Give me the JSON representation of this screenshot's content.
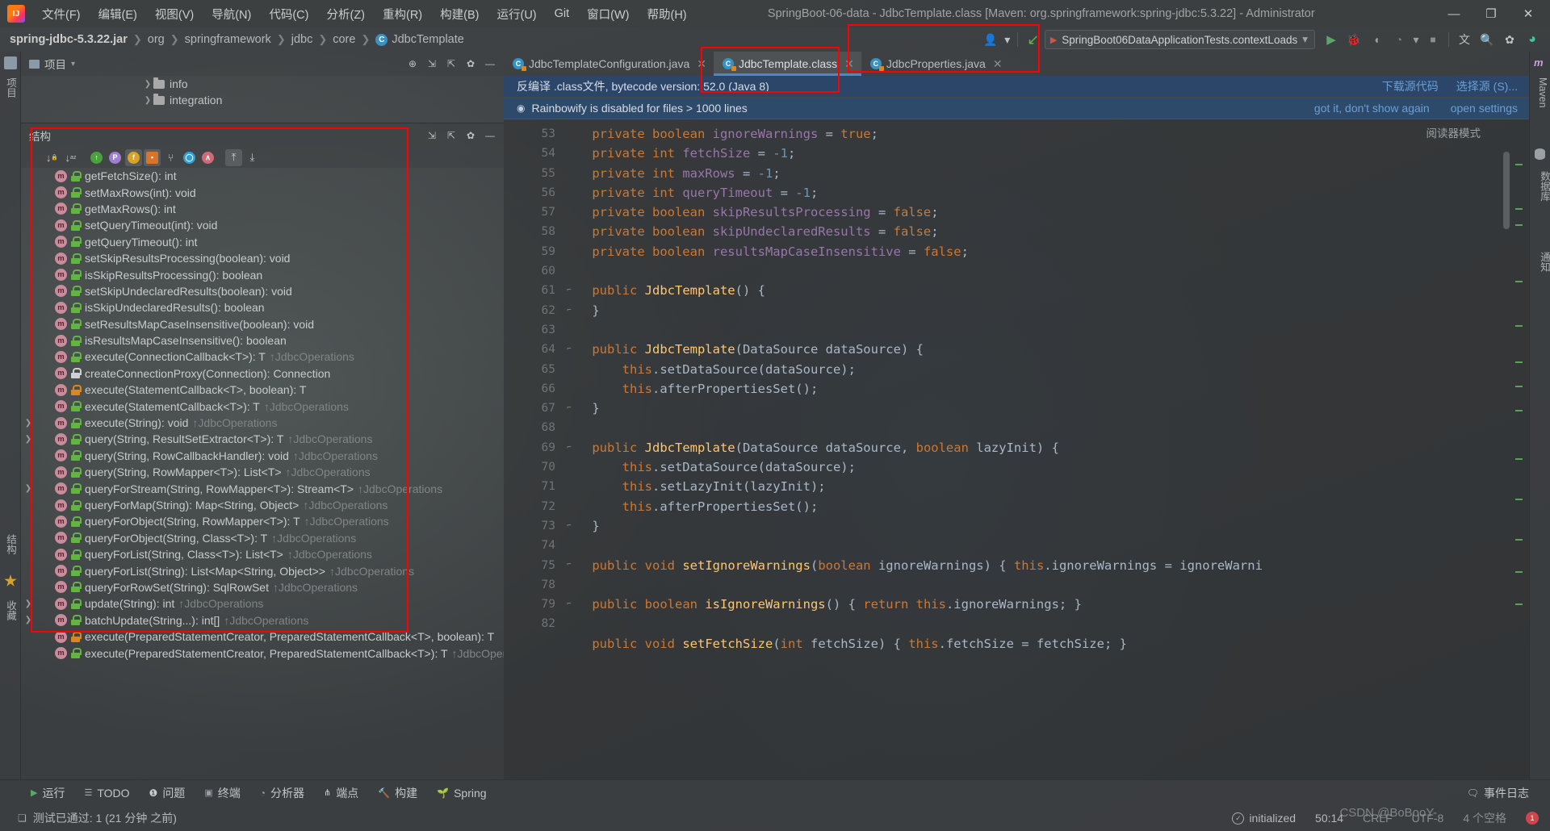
{
  "window": {
    "title": "SpringBoot-06-data - JdbcTemplate.class [Maven: org.springframework:spring-jdbc:5.3.22] - Administrator",
    "minimize": "—",
    "maximize": "❐",
    "close": "✕"
  },
  "menubar": {
    "items": [
      {
        "label": "文件(F)"
      },
      {
        "label": "编辑(E)"
      },
      {
        "label": "视图(V)"
      },
      {
        "label": "导航(N)"
      },
      {
        "label": "代码(C)"
      },
      {
        "label": "分析(Z)"
      },
      {
        "label": "重构(R)"
      },
      {
        "label": "构建(B)"
      },
      {
        "label": "运行(U)"
      },
      {
        "label": "Git"
      },
      {
        "label": "窗口(W)"
      },
      {
        "label": "帮助(H)"
      }
    ]
  },
  "breadcrumb": {
    "items": [
      "spring-jdbc-5.3.22.jar",
      "org",
      "springframework",
      "jdbc",
      "core",
      "JdbcTemplate"
    ],
    "separator": "❯",
    "class_icon": "C"
  },
  "run_toolbar": {
    "config_label": "SpringBoot06DataApplicationTests.contextLoads",
    "config_chevron": "▾",
    "run_icon": "▶",
    "debug_icon": "🐞",
    "run_coverage_icon": "◖",
    "profile_icon": "◔",
    "profile_chevron": "▾",
    "stop_icon": "■",
    "translate_icon": "文",
    "search_icon": "🔍",
    "settings_icon": "✿",
    "avatar_icon": "◕",
    "user_icon": "👤",
    "user_chevron": "▾",
    "vcs_update_icon": "↙"
  },
  "project_pane": {
    "title": "项目",
    "chevron": "▾",
    "actions": [
      "⊕",
      "⇲",
      "⇱",
      "✿",
      "—"
    ],
    "rows": [
      {
        "label": "info",
        "arrow": "❯"
      },
      {
        "label": "integration",
        "arrow": "❯"
      }
    ]
  },
  "structure_pane": {
    "title": "结构",
    "actions": [
      "⇲",
      "⇱",
      "✿",
      "—"
    ],
    "toolbar": [
      {
        "name": "sort-by-visibility",
        "glyph": "↓"
      },
      {
        "name": "sort-alphabetically",
        "glyph": "↓"
      },
      {
        "name": "show-inherited",
        "glyph": "↑",
        "color": "#62b543"
      },
      {
        "name": "show-properties",
        "glyph": "P",
        "color": "#9f7fd4"
      },
      {
        "name": "show-fields",
        "glyph": "f",
        "color": "#d9a22a"
      },
      {
        "name": "show-non-public",
        "glyph": "▪",
        "color": "#5a5d5f"
      },
      {
        "name": "show-anonymous",
        "glyph": "⑂",
        "color": "#c8cbcd"
      },
      {
        "name": "show-lambdas",
        "glyph": "◯",
        "color": "#3592c4"
      },
      {
        "name": "show-overrides",
        "glyph": "∧",
        "color": "#cf6a7a"
      },
      {
        "name": "expand-all",
        "glyph": "⤒"
      },
      {
        "name": "collapse-all",
        "glyph": "⤓"
      }
    ],
    "members": [
      {
        "name": "getFetchSize(): int",
        "vis": "pub",
        "arrow": "",
        "owner": ""
      },
      {
        "name": "setMaxRows(int): void",
        "vis": "pub",
        "arrow": "",
        "owner": ""
      },
      {
        "name": "getMaxRows(): int",
        "vis": "pub",
        "arrow": "",
        "owner": ""
      },
      {
        "name": "setQueryTimeout(int): void",
        "vis": "pub",
        "arrow": "",
        "owner": ""
      },
      {
        "name": "getQueryTimeout(): int",
        "vis": "pub",
        "arrow": "",
        "owner": ""
      },
      {
        "name": "setSkipResultsProcessing(boolean): void",
        "vis": "pub",
        "arrow": "",
        "owner": ""
      },
      {
        "name": "isSkipResultsProcessing(): boolean",
        "vis": "pub",
        "arrow": "",
        "owner": ""
      },
      {
        "name": "setSkipUndeclaredResults(boolean): void",
        "vis": "pub",
        "arrow": "",
        "owner": ""
      },
      {
        "name": "isSkipUndeclaredResults(): boolean",
        "vis": "pub",
        "arrow": "",
        "owner": ""
      },
      {
        "name": "setResultsMapCaseInsensitive(boolean): void",
        "vis": "pub",
        "arrow": "",
        "owner": ""
      },
      {
        "name": "isResultsMapCaseInsensitive(): boolean",
        "vis": "pub",
        "arrow": "",
        "owner": ""
      },
      {
        "name": "execute(ConnectionCallback<T>): T",
        "vis": "pub",
        "arrow": "",
        "owner": "↑JdbcOperations"
      },
      {
        "name": "createConnectionProxy(Connection): Connection",
        "vis": "priv",
        "arrow": "",
        "owner": ""
      },
      {
        "name": "execute(StatementCallback<T>, boolean): T",
        "vis": "prot",
        "arrow": "",
        "owner": ""
      },
      {
        "name": "execute(StatementCallback<T>): T",
        "vis": "pub",
        "arrow": "",
        "owner": "↑JdbcOperations"
      },
      {
        "name": "execute(String): void",
        "vis": "pub",
        "arrow": "❯",
        "owner": "↑JdbcOperations"
      },
      {
        "name": "query(String, ResultSetExtractor<T>): T",
        "vis": "pub",
        "arrow": "❯",
        "owner": "↑JdbcOperations"
      },
      {
        "name": "query(String, RowCallbackHandler): void",
        "vis": "pub",
        "arrow": "",
        "owner": "↑JdbcOperations"
      },
      {
        "name": "query(String, RowMapper<T>): List<T>",
        "vis": "pub",
        "arrow": "",
        "owner": "↑JdbcOperations"
      },
      {
        "name": "queryForStream(String, RowMapper<T>): Stream<T>",
        "vis": "pub",
        "arrow": "❯",
        "owner": "↑JdbcOperations"
      },
      {
        "name": "queryForMap(String): Map<String, Object>",
        "vis": "pub",
        "arrow": "",
        "owner": "↑JdbcOperations"
      },
      {
        "name": "queryForObject(String, RowMapper<T>): T",
        "vis": "pub",
        "arrow": "",
        "owner": "↑JdbcOperations"
      },
      {
        "name": "queryForObject(String, Class<T>): T",
        "vis": "pub",
        "arrow": "",
        "owner": "↑JdbcOperations"
      },
      {
        "name": "queryForList(String, Class<T>): List<T>",
        "vis": "pub",
        "arrow": "",
        "owner": "↑JdbcOperations"
      },
      {
        "name": "queryForList(String): List<Map<String, Object>>",
        "vis": "pub",
        "arrow": "",
        "owner": "↑JdbcOperations"
      },
      {
        "name": "queryForRowSet(String): SqlRowSet",
        "vis": "pub",
        "arrow": "",
        "owner": "↑JdbcOperations"
      },
      {
        "name": "update(String): int",
        "vis": "pub",
        "arrow": "❯",
        "owner": "↑JdbcOperations"
      },
      {
        "name": "batchUpdate(String...): int[]",
        "vis": "pub",
        "arrow": "❯",
        "owner": "↑JdbcOperations"
      },
      {
        "name": "execute(PreparedStatementCreator, PreparedStatementCallback<T>, boolean): T",
        "vis": "prot",
        "arrow": "",
        "owner": ""
      },
      {
        "name": "execute(PreparedStatementCreator, PreparedStatementCallback<T>): T",
        "vis": "pub",
        "arrow": "",
        "owner": "↑JdbcOperatio"
      }
    ]
  },
  "editor": {
    "tabs": [
      {
        "label": "JdbcTemplateConfiguration.java",
        "active": false,
        "close": "✕"
      },
      {
        "label": "JdbcTemplate.class",
        "active": true,
        "close": "✕"
      },
      {
        "label": "JdbcProperties.java",
        "active": false,
        "close": "✕"
      }
    ],
    "decompile_notice": {
      "text": "反编译 .class文件, bytecode version: 52.0 (Java 8)",
      "links": [
        "下载源代码",
        "选择源 (S)..."
      ]
    },
    "rainbowify_notice": {
      "icon": "◉",
      "text": "Rainbowify is disabled for files > 1000 lines",
      "links": [
        "got it, don't show again",
        "open settings"
      ]
    },
    "reader_mode_label": "阅读器模式",
    "lines": [
      {
        "n": "53",
        "fold": "",
        "tokens": [
          {
            "t": "    ",
            "c": "def"
          },
          {
            "t": "private ",
            "c": "kw"
          },
          {
            "t": "boolean ",
            "c": "kw"
          },
          {
            "t": "ignoreWarnings",
            "c": "fld"
          },
          {
            "t": " = ",
            "c": "def"
          },
          {
            "t": "true",
            "c": "kw"
          },
          {
            "t": ";",
            "c": "def"
          }
        ]
      },
      {
        "n": "54",
        "fold": "",
        "tokens": [
          {
            "t": "    ",
            "c": "def"
          },
          {
            "t": "private ",
            "c": "kw"
          },
          {
            "t": "int ",
            "c": "kw"
          },
          {
            "t": "fetchSize",
            "c": "fld"
          },
          {
            "t": " = ",
            "c": "def"
          },
          {
            "t": "-1",
            "c": "num"
          },
          {
            "t": ";",
            "c": "def"
          }
        ]
      },
      {
        "n": "55",
        "fold": "",
        "tokens": [
          {
            "t": "    ",
            "c": "def"
          },
          {
            "t": "private ",
            "c": "kw"
          },
          {
            "t": "int ",
            "c": "kw"
          },
          {
            "t": "maxRows",
            "c": "fld"
          },
          {
            "t": " = ",
            "c": "def"
          },
          {
            "t": "-1",
            "c": "num"
          },
          {
            "t": ";",
            "c": "def"
          }
        ]
      },
      {
        "n": "56",
        "fold": "",
        "tokens": [
          {
            "t": "    ",
            "c": "def"
          },
          {
            "t": "private ",
            "c": "kw"
          },
          {
            "t": "int ",
            "c": "kw"
          },
          {
            "t": "queryTimeout",
            "c": "fld"
          },
          {
            "t": " = ",
            "c": "def"
          },
          {
            "t": "-1",
            "c": "num"
          },
          {
            "t": ";",
            "c": "def"
          }
        ]
      },
      {
        "n": "57",
        "fold": "",
        "tokens": [
          {
            "t": "    ",
            "c": "def"
          },
          {
            "t": "private ",
            "c": "kw"
          },
          {
            "t": "boolean ",
            "c": "kw"
          },
          {
            "t": "skipResultsProcessing",
            "c": "fld"
          },
          {
            "t": " = ",
            "c": "def"
          },
          {
            "t": "false",
            "c": "kw"
          },
          {
            "t": ";",
            "c": "def"
          }
        ]
      },
      {
        "n": "58",
        "fold": "",
        "tokens": [
          {
            "t": "    ",
            "c": "def"
          },
          {
            "t": "private ",
            "c": "kw"
          },
          {
            "t": "boolean ",
            "c": "kw"
          },
          {
            "t": "skipUndeclaredResults",
            "c": "fld"
          },
          {
            "t": " = ",
            "c": "def"
          },
          {
            "t": "false",
            "c": "kw"
          },
          {
            "t": ";",
            "c": "def"
          }
        ]
      },
      {
        "n": "59",
        "fold": "",
        "tokens": [
          {
            "t": "    ",
            "c": "def"
          },
          {
            "t": "private ",
            "c": "kw"
          },
          {
            "t": "boolean ",
            "c": "kw"
          },
          {
            "t": "resultsMapCaseInsensitive",
            "c": "fld"
          },
          {
            "t": " = ",
            "c": "def"
          },
          {
            "t": "false",
            "c": "kw"
          },
          {
            "t": ";",
            "c": "def"
          }
        ]
      },
      {
        "n": "60",
        "fold": "",
        "tokens": []
      },
      {
        "n": "61",
        "fold": "⌐",
        "tokens": [
          {
            "t": "    ",
            "c": "def"
          },
          {
            "t": "public ",
            "c": "kw"
          },
          {
            "t": "JdbcTemplate",
            "c": "fn"
          },
          {
            "t": "() {",
            "c": "def"
          }
        ]
      },
      {
        "n": "62",
        "fold": "⌐",
        "tokens": [
          {
            "t": "    }",
            "c": "def"
          }
        ]
      },
      {
        "n": "63",
        "fold": "",
        "tokens": []
      },
      {
        "n": "64",
        "fold": "⌐",
        "tokens": [
          {
            "t": "    ",
            "c": "def"
          },
          {
            "t": "public ",
            "c": "kw"
          },
          {
            "t": "JdbcTemplate",
            "c": "fn"
          },
          {
            "t": "(DataSource dataSource) {",
            "c": "def"
          }
        ]
      },
      {
        "n": "65",
        "fold": "",
        "tokens": [
          {
            "t": "        ",
            "c": "def"
          },
          {
            "t": "this",
            "c": "kw"
          },
          {
            "t": ".setDataSource(dataSource);",
            "c": "def"
          }
        ]
      },
      {
        "n": "66",
        "fold": "",
        "tokens": [
          {
            "t": "        ",
            "c": "def"
          },
          {
            "t": "this",
            "c": "kw"
          },
          {
            "t": ".afterPropertiesSet();",
            "c": "def"
          }
        ]
      },
      {
        "n": "67",
        "fold": "⌐",
        "tokens": [
          {
            "t": "    }",
            "c": "def"
          }
        ]
      },
      {
        "n": "68",
        "fold": "",
        "tokens": []
      },
      {
        "n": "69",
        "fold": "⌐",
        "tokens": [
          {
            "t": "    ",
            "c": "def"
          },
          {
            "t": "public ",
            "c": "kw"
          },
          {
            "t": "JdbcTemplate",
            "c": "fn"
          },
          {
            "t": "(DataSource dataSource, ",
            "c": "def"
          },
          {
            "t": "boolean ",
            "c": "kw"
          },
          {
            "t": "lazyInit) {",
            "c": "def"
          }
        ]
      },
      {
        "n": "70",
        "fold": "",
        "tokens": [
          {
            "t": "        ",
            "c": "def"
          },
          {
            "t": "this",
            "c": "kw"
          },
          {
            "t": ".setDataSource(dataSource);",
            "c": "def"
          }
        ]
      },
      {
        "n": "71",
        "fold": "",
        "tokens": [
          {
            "t": "        ",
            "c": "def"
          },
          {
            "t": "this",
            "c": "kw"
          },
          {
            "t": ".setLazyInit(lazyInit);",
            "c": "def"
          }
        ]
      },
      {
        "n": "72",
        "fold": "",
        "tokens": [
          {
            "t": "        ",
            "c": "def"
          },
          {
            "t": "this",
            "c": "kw"
          },
          {
            "t": ".afterPropertiesSet();",
            "c": "def"
          }
        ]
      },
      {
        "n": "73",
        "fold": "⌐",
        "tokens": [
          {
            "t": "    }",
            "c": "def"
          }
        ]
      },
      {
        "n": "74",
        "fold": "",
        "tokens": []
      },
      {
        "n": "75",
        "fold": "⌐",
        "tokens": [
          {
            "t": "    ",
            "c": "def"
          },
          {
            "t": "public ",
            "c": "kw"
          },
          {
            "t": "void ",
            "c": "kw"
          },
          {
            "t": "setIgnoreWarnings",
            "c": "fn"
          },
          {
            "t": "(",
            "c": "def"
          },
          {
            "t": "boolean ",
            "c": "kw"
          },
          {
            "t": "ignoreWarnings) { ",
            "c": "def"
          },
          {
            "t": "this",
            "c": "kw"
          },
          {
            "t": ".ignoreWarnings = ignoreWarni",
            "c": "def"
          }
        ]
      },
      {
        "n": "78",
        "fold": "",
        "tokens": []
      },
      {
        "n": "79",
        "fold": "⌐",
        "tokens": [
          {
            "t": "    ",
            "c": "def"
          },
          {
            "t": "public ",
            "c": "kw"
          },
          {
            "t": "boolean ",
            "c": "kw"
          },
          {
            "t": "isIgnoreWarnings",
            "c": "fn"
          },
          {
            "t": "() { ",
            "c": "def"
          },
          {
            "t": "return ",
            "c": "kw"
          },
          {
            "t": "this",
            "c": "kw"
          },
          {
            "t": ".ignoreWarnings; }",
            "c": "def"
          }
        ]
      },
      {
        "n": "82",
        "fold": "",
        "tokens": []
      },
      {
        "n": "",
        "fold": "",
        "tokens": [
          {
            "t": "    ",
            "c": "def"
          },
          {
            "t": "public ",
            "c": "kw"
          },
          {
            "t": "void ",
            "c": "kw"
          },
          {
            "t": "setFetchSize",
            "c": "fn"
          },
          {
            "t": "(",
            "c": "def"
          },
          {
            "t": "int ",
            "c": "kw"
          },
          {
            "t": "fetchSize) { ",
            "c": "def"
          },
          {
            "t": "this",
            "c": "kw"
          },
          {
            "t": ".fetchSize = fetchSize; }",
            "c": "def"
          }
        ]
      }
    ]
  },
  "left_rail": {
    "tabs": [
      {
        "label": "项目",
        "icon": "project-icon"
      },
      {
        "label": "结构",
        "icon": "structure-icon"
      },
      {
        "label": "收藏",
        "icon": "favorites-icon"
      }
    ]
  },
  "right_rail": {
    "tabs": [
      {
        "label": "Maven",
        "icon": "maven-icon"
      },
      {
        "label": "数据库",
        "icon": "database-icon"
      },
      {
        "label": "通知",
        "icon": "notifications-icon"
      }
    ]
  },
  "tool_window_bar": {
    "buttons": [
      {
        "label": "运行",
        "icon": "run-icon"
      },
      {
        "label": "TODO",
        "icon": "todo-icon"
      },
      {
        "label": "问题",
        "icon": "problems-icon"
      },
      {
        "label": "终端",
        "icon": "terminal-icon"
      },
      {
        "label": "分析器",
        "icon": "profiler-icon"
      },
      {
        "label": "端点",
        "icon": "endpoints-icon"
      },
      {
        "label": "构建",
        "icon": "build-icon"
      },
      {
        "label": "Spring",
        "icon": "spring-icon"
      }
    ],
    "event_log": "事件日志"
  },
  "statusbar": {
    "test_status": "测试已通过: 1 (21 分钟 之前)",
    "indexing": "initialized",
    "caret": "50:14",
    "line_sep": "CRLF",
    "encoding": "UTF-8",
    "indent": "4 个空格",
    "watermark": "CSDN @BoBooY-",
    "notification_count": "1"
  }
}
